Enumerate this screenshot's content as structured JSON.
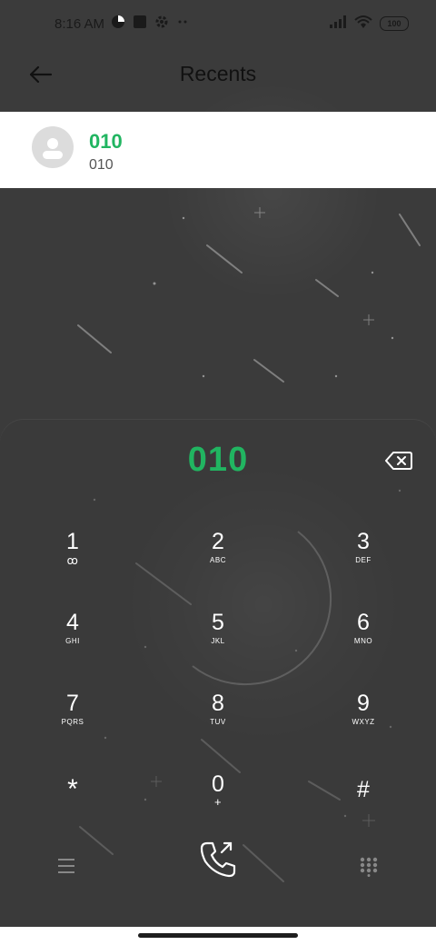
{
  "status_bar": {
    "time": "8:16 AM",
    "battery": "100"
  },
  "app_bar": {
    "title": "Recents"
  },
  "recent_entry": {
    "name": "010",
    "number": "010"
  },
  "dialer": {
    "digits": "010",
    "keys": [
      {
        "num": "1",
        "sub": "ꝏ"
      },
      {
        "num": "2",
        "sub": "ABC"
      },
      {
        "num": "3",
        "sub": "DEF"
      },
      {
        "num": "4",
        "sub": "GHI"
      },
      {
        "num": "5",
        "sub": "JKL"
      },
      {
        "num": "6",
        "sub": "MNO"
      },
      {
        "num": "7",
        "sub": "PQRS"
      },
      {
        "num": "8",
        "sub": "TUV"
      },
      {
        "num": "9",
        "sub": "WXYZ"
      },
      {
        "num": "*",
        "sub": ""
      },
      {
        "num": "0",
        "sub": "+"
      },
      {
        "num": "#",
        "sub": ""
      }
    ]
  },
  "colors": {
    "accent_green": "#21b561",
    "background": "#3b3b3b"
  },
  "icons": [
    "back-arrow-icon",
    "avatar-icon",
    "backspace-icon",
    "menu-icon",
    "call-icon",
    "keypad-icon",
    "wifi-icon",
    "signal-icon"
  ]
}
